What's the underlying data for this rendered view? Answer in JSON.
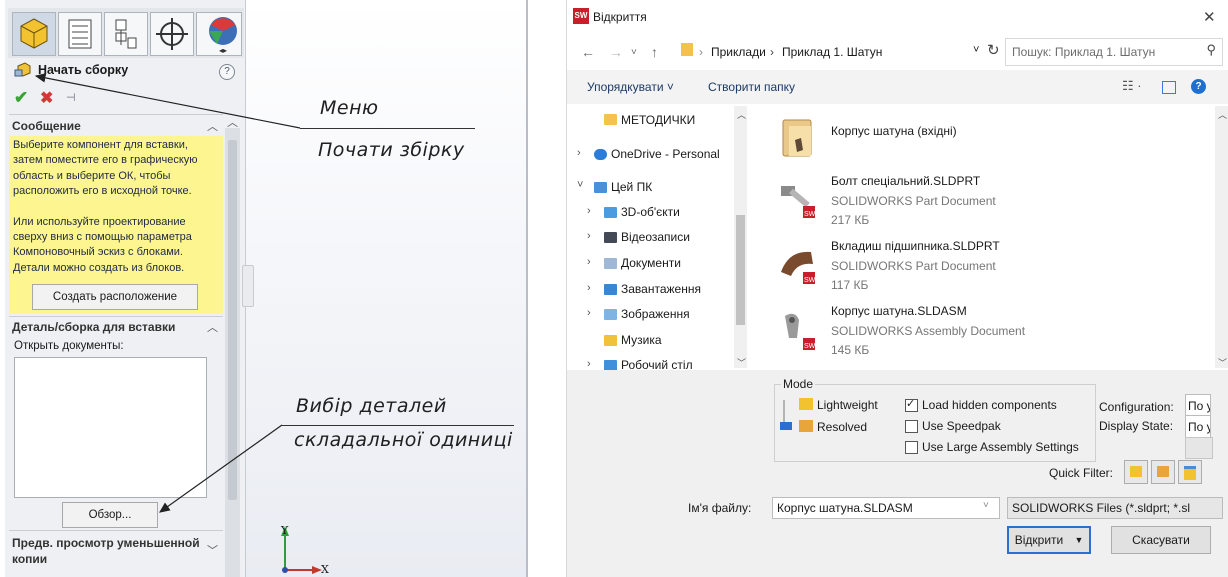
{
  "solidworks": {
    "panel_title": "Начать сборку",
    "help": "?",
    "ok": "✔",
    "cancel": "✖",
    "pin": "⊣",
    "message_header": "Сообщение",
    "message_lines": [
      "Выберите компонент для вставки,",
      "затем поместите его в графическую",
      "область и выберите ОК, чтобы",
      "расположить его в исходной точке.",
      "",
      "Или используйте проектирование",
      "сверху вниз с помощью параметра",
      "Компоновочный эскиз с блоками.",
      "Детали можно создать из блоков."
    ],
    "create_layout_button": "Создать расположение",
    "insert_header": "Деталь/сборка для вставки",
    "open_documents_label": "Открыть документы:",
    "browse_button": "Обзор...",
    "preview_header_line1": "Предв. просмотр уменьшенной",
    "preview_header_line2": "копии",
    "axis_y": "Y",
    "axis_x": "X",
    "note1_line1": "Меню",
    "note1_line2": "Почати збірку",
    "note2_line1": "Вибір деталей",
    "note2_line2": "складальної одиниці"
  },
  "dialog": {
    "title": "Відкриття",
    "logo": "SW",
    "close": "✕",
    "breadcrumb": [
      "Приклади",
      "Приклад 1. Шатун"
    ],
    "search_placeholder": "Пошук: Приклад 1. Шатун",
    "organize": "Упорядкувати ˅",
    "new_folder": "Створити папку",
    "nav_items": [
      {
        "label": "МЕТОДИЧКИ"
      },
      {
        "label": "OneDrive - Personal"
      },
      {
        "label": "Цей ПК"
      },
      {
        "label": "3D-об'єкти"
      },
      {
        "label": "Відеозаписи"
      },
      {
        "label": "Документи"
      },
      {
        "label": "Завантаження"
      },
      {
        "label": "Зображення"
      },
      {
        "label": "Музика"
      },
      {
        "label": "Робочий стіл"
      }
    ],
    "files": [
      {
        "name": "Корпус шатуна (вхідні)",
        "type": "",
        "size": ""
      },
      {
        "name": "Болт спеціальний.SLDPRT",
        "type": "SOLIDWORKS Part Document",
        "size": "217 КБ"
      },
      {
        "name": "Вкладиш підшипника.SLDPRT",
        "type": "SOLIDWORKS Part Document",
        "size": "117 КБ"
      },
      {
        "name": "Корпус шатуна.SLDASM",
        "type": "SOLIDWORKS Assembly Document",
        "size": "145 КБ"
      }
    ],
    "mode_label": "Mode",
    "lightweight": "Lightweight",
    "resolved": "Resolved",
    "load_hidden": "Load hidden components",
    "use_speedpak": "Use Speedpak",
    "use_large": "Use Large Assembly Settings",
    "configuration_label": "Configuration:",
    "configuration_value": "По у",
    "display_state_label": "Display State:",
    "display_state_value": "По у",
    "quick_filter": "Quick Filter:",
    "filename_label": "Ім'я файлу:",
    "filename_value": "Корпус шатуна.SLDASM",
    "filetype_value": "SOLIDWORKS Files (*.sldprt; *.sl",
    "open_button": "Відкрити",
    "cancel_button": "Скасувати"
  }
}
